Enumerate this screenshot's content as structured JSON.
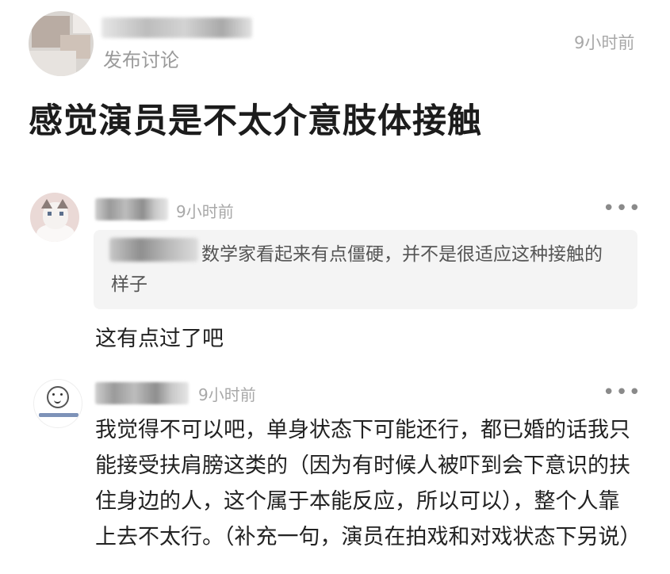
{
  "post": {
    "subtitle": "发布讨论",
    "time": "9小时前",
    "title": "感觉演员是不太介意肢体接触"
  },
  "comments": [
    {
      "time": "9小时前",
      "more_icon": "more-dots-icon",
      "quote_text": "数学家看起来有点僵硬，并不是很适应这种接触的样子",
      "text": "这有点过了吧"
    },
    {
      "time": "9小时前",
      "more_icon": "more-dots-icon",
      "text": "我觉得不可以吧，单身状态下可能还行，都已婚的话我只能接受扶肩膀这类的（因为有时候人被吓到会下意识的扶住身边的人，这个属于本能反应，所以可以），整个人靠上去不太行。（补充一句，演员在拍戏和对戏状态下另说）"
    }
  ]
}
